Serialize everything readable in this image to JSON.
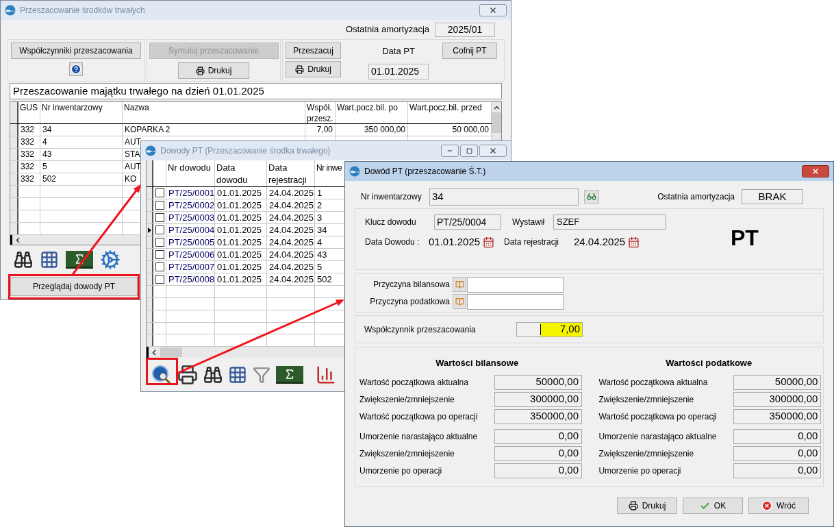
{
  "main_window": {
    "title": "Przeszacowanie środków trwałych",
    "active": false,
    "last_amortization": {
      "label": "Ostatnia amortyzacja",
      "value": "2025/01"
    },
    "coefficients_button": {
      "label": "Współczynniki przeszacowania",
      "disabled": false
    },
    "simulate_button": {
      "label": "Symuluj przeszacowanie",
      "disabled": true
    },
    "simulate_print_button": {
      "label": "Drukuj",
      "disabled": false
    },
    "revalue_button": {
      "label": "Przeszacuj",
      "disabled": false
    },
    "revalue_print_button": {
      "label": "Drukuj",
      "disabled": false
    },
    "pt_date": {
      "label": "Data PT",
      "value": "01.01.2025"
    },
    "undo_button": {
      "label": "Cofnij PT",
      "disabled": false
    },
    "heading": "Przeszacowanie majątku trwałego na dzień 01.01.2025",
    "table": {
      "columns": [
        "GUS",
        "Nr inwentarzowy",
        "Nazwa",
        "Współ. przesz.",
        "Wart.pocz.bil. po",
        "Wart.pocz.bil. przed"
      ],
      "rows": [
        {
          "gus": "332",
          "inventory_number": "34",
          "name": "KOPARKA 2",
          "coefficient": "7,00",
          "value_after": "350 000,00",
          "value_before": "50 000,00"
        },
        {
          "gus": "332",
          "inventory_number": "4",
          "name": "AUT"
        },
        {
          "gus": "332",
          "inventory_number": "43",
          "name": "STA"
        },
        {
          "gus": "332",
          "inventory_number": "5",
          "name": "AUT"
        },
        {
          "gus": "332",
          "inventory_number": "502",
          "name": "KO"
        }
      ]
    },
    "browse_button": {
      "label": "Przeglądaj dowody PT",
      "highlighted": true
    }
  },
  "documents_window": {
    "title": "Dowody PT (Przeszacowanie środka trwałego)",
    "active": false,
    "columns": [
      "Nr dowodu",
      "Data dowodu",
      "Data rejestracji",
      "Nr inwe"
    ],
    "rows": [
      {
        "checked": false,
        "selected": false,
        "number": "PT/25/0001",
        "document_date": "01.01.2025",
        "registration_date": "24.04.2025",
        "inventory_number": "1"
      },
      {
        "checked": false,
        "selected": false,
        "number": "PT/25/0002",
        "document_date": "01.01.2025",
        "registration_date": "24.04.2025",
        "inventory_number": "2"
      },
      {
        "checked": false,
        "selected": false,
        "number": "PT/25/0003",
        "document_date": "01.01.2025",
        "registration_date": "24.04.2025",
        "inventory_number": "3"
      },
      {
        "checked": false,
        "selected": true,
        "number": "PT/25/0004",
        "document_date": "01.01.2025",
        "registration_date": "24.04.2025",
        "inventory_number": "34"
      },
      {
        "checked": false,
        "selected": false,
        "number": "PT/25/0005",
        "document_date": "01.01.2025",
        "registration_date": "24.04.2025",
        "inventory_number": "4"
      },
      {
        "checked": false,
        "selected": false,
        "number": "PT/25/0006",
        "document_date": "01.01.2025",
        "registration_date": "24.04.2025",
        "inventory_number": "43"
      },
      {
        "checked": false,
        "selected": false,
        "number": "PT/25/0007",
        "document_date": "01.01.2025",
        "registration_date": "24.04.2025",
        "inventory_number": "5"
      },
      {
        "checked": false,
        "selected": false,
        "number": "PT/25/0008",
        "document_date": "01.01.2025",
        "registration_date": "24.04.2025",
        "inventory_number": "502"
      }
    ],
    "preview_tool_highlighted": true
  },
  "document_dialog": {
    "title": "Dowód PT (przeszacowanie Ś.T.)",
    "active": true,
    "inventory_number": {
      "label": "Nr inwentarzowy",
      "value": "34"
    },
    "last_amortization": {
      "label": "Ostatnia amortyzacja",
      "value": "BRAK"
    },
    "document_key": {
      "label": "Klucz dowodu",
      "value": "PT/25/0004"
    },
    "issued_by": {
      "label": "Wystawił",
      "value": "SZEF"
    },
    "document_date": {
      "label": "Data Dowodu :",
      "value": "01.01.2025"
    },
    "registration_date": {
      "label": "Data rejestracji",
      "value": "24.04.2025"
    },
    "type_mark": "PT",
    "reasons": [
      {
        "label": "Przyczyna bilansowa"
      },
      {
        "label": "Przyczyna podatkowa"
      }
    ],
    "coefficient": {
      "label": "Współczynnik przeszacowania",
      "value": "7,00"
    },
    "sections": [
      {
        "title": "Wartości bilansowe",
        "rows": [
          {
            "label": "Wartość początkowa aktualna",
            "value": "50000,00"
          },
          {
            "label": "Zwiększenie/zmniejszenie",
            "value": "300000,00"
          },
          {
            "label": "Wartość początkowa po operacji",
            "value": "350000,00"
          },
          {
            "label": "Umorzenie narastająco aktualne",
            "value": "0,00"
          },
          {
            "label": "Zwiększenie/zmniejszenie",
            "value": "0,00"
          },
          {
            "label": "Umorzenie po operacji",
            "value": "0,00"
          }
        ]
      },
      {
        "title": "Wartości podatkowe",
        "rows": [
          {
            "label": "Wartość początkowa aktualna",
            "value": "50000,00"
          },
          {
            "label": "Zwiększenie/zmniejszenie",
            "value": "300000,00"
          },
          {
            "label": "Wartość początkowa po operacji",
            "value": "350000,00"
          },
          {
            "label": "Umorzenie narastająco aktualne",
            "value": "0,00"
          },
          {
            "label": "Zwiększenie/zmniejszenie",
            "value": "0,00"
          },
          {
            "label": "Umorzenie po operacji",
            "value": "0,00"
          }
        ]
      }
    ],
    "buttons": [
      {
        "kind": "print",
        "label": "Drukuj"
      },
      {
        "kind": "ok",
        "label": "OK"
      },
      {
        "kind": "back",
        "label": "Wróć"
      }
    ]
  }
}
